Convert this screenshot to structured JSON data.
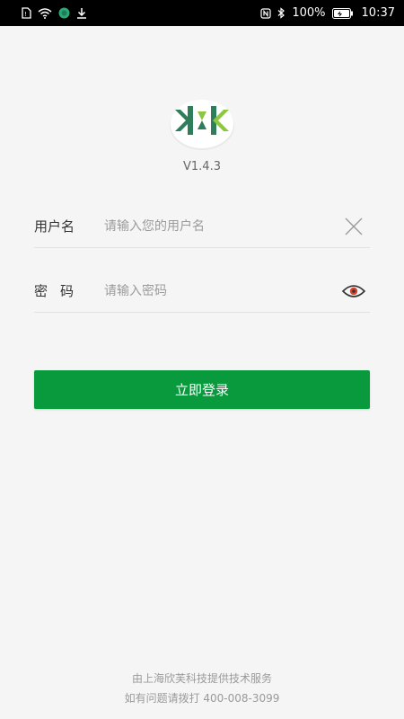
{
  "status_bar": {
    "battery_percent": "100%",
    "time": "10:37",
    "icons": [
      "sim-icon",
      "wifi-icon",
      "app-icon",
      "download-icon",
      "nfc-icon",
      "bluetooth-icon",
      "battery-icon"
    ]
  },
  "app": {
    "version": "V1.4.3",
    "accent_color": "#0a9a3e",
    "logo_colors": [
      "#2e7d5b",
      "#8dc63f"
    ]
  },
  "form": {
    "username": {
      "label": "用户名",
      "placeholder": "请输入您的用户名",
      "value": ""
    },
    "password": {
      "label": "密码",
      "placeholder": "请输入密码",
      "value": ""
    },
    "login_label": "立即登录"
  },
  "footer": {
    "line1": "由上海欣芙科技提供技术服务",
    "line2": "如有问题请拨打 400-008-3099"
  }
}
